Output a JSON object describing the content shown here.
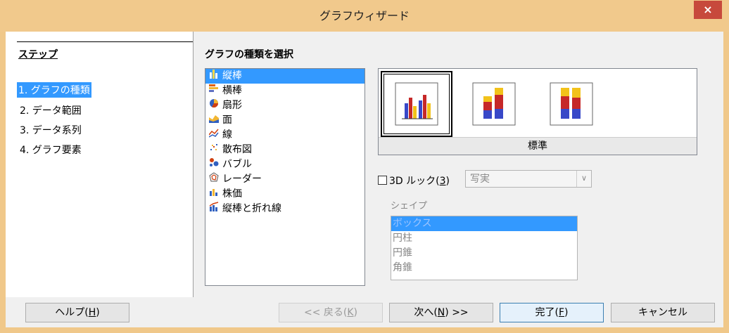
{
  "window": {
    "title": "グラフウィザード",
    "close_glyph": "×"
  },
  "steps": {
    "title": "ステップ",
    "items": [
      "1. グラフの種類",
      "2. データ範囲",
      "3. データ系列",
      "4. グラフ要素"
    ]
  },
  "main": {
    "section_title": "グラフの種類を選択",
    "chart_types": [
      {
        "label": "縦棒",
        "icon": "column-chart-icon"
      },
      {
        "label": "横棒",
        "icon": "bar-chart-icon"
      },
      {
        "label": "扇形",
        "icon": "pie-chart-icon"
      },
      {
        "label": "面",
        "icon": "area-chart-icon"
      },
      {
        "label": "線",
        "icon": "line-chart-icon"
      },
      {
        "label": "散布図",
        "icon": "scatter-chart-icon"
      },
      {
        "label": "バブル",
        "icon": "bubble-chart-icon"
      },
      {
        "label": "レーダー",
        "icon": "radar-chart-icon"
      },
      {
        "label": "株価",
        "icon": "stock-chart-icon"
      },
      {
        "label": "縦棒と折れ線",
        "icon": "column-line-chart-icon"
      }
    ],
    "variant_label": "標準",
    "three_d": {
      "label_prefix": "3D ルック(",
      "mnemonic": "3",
      "label_suffix": ")",
      "combo_value": "写実"
    },
    "shape": {
      "label": "シェイプ",
      "items": [
        "ボックス",
        "円柱",
        "円錐",
        "角錐"
      ]
    }
  },
  "buttons": {
    "help": {
      "prefix": "ヘルプ(",
      "key": "H",
      "suffix": ")"
    },
    "back": {
      "prefix": "<< 戻る(",
      "key": "K",
      "suffix": ")"
    },
    "next": {
      "prefix": "次へ(",
      "key": "N",
      "suffix": ") >>"
    },
    "finish": {
      "prefix": "完了(",
      "key": "F",
      "suffix": ")"
    },
    "cancel": "キャンセル"
  }
}
